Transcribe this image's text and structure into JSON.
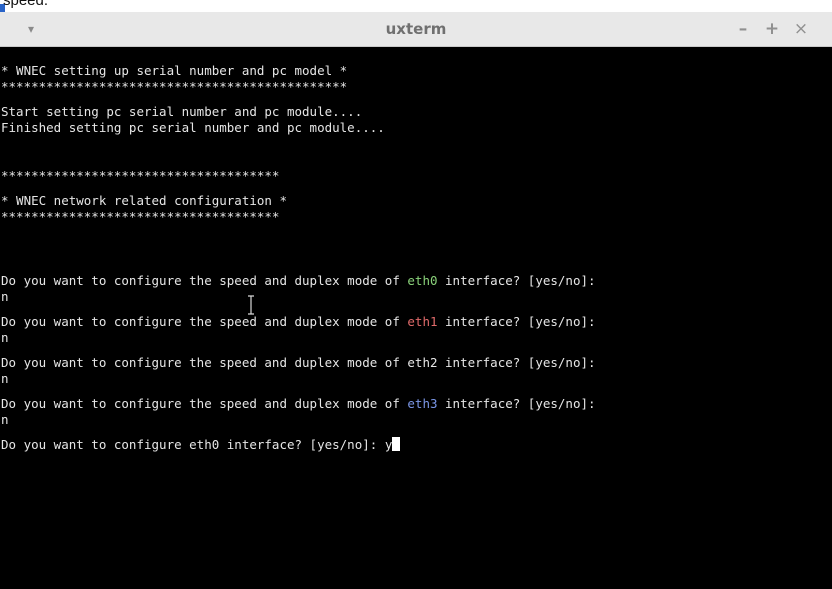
{
  "page": {
    "top_fragment_text": "speed."
  },
  "window": {
    "title": "uxterm",
    "menu_icon": "▾",
    "minimize_label": "–",
    "maximize_label": "+",
    "close_label": "×"
  },
  "terminal": {
    "lines": {
      "l1": "* WNEC setting up serial number and pc model *",
      "l2": "**********************************************",
      "l3": "Start setting pc serial number and pc module....",
      "l4": "Finished setting pc serial number and pc module....",
      "l5": "*************************************",
      "l6": "* WNEC network related configuration *",
      "l7": "*************************************"
    },
    "questions": [
      {
        "prefix": "Do you want to configure the speed and duplex mode of ",
        "iface": "eth0",
        "suffix": " interface? [yes/no]:",
        "answer": "n"
      },
      {
        "prefix": "Do you want to configure the speed and duplex mode of ",
        "iface": "eth1",
        "suffix": " interface? [yes/no]:",
        "answer": "n"
      },
      {
        "prefix": "Do you want to configure the speed and duplex mode of ",
        "iface": "eth2",
        "suffix": " interface? [yes/no]:",
        "answer": "n"
      },
      {
        "prefix": "Do you want to configure the speed and duplex mode of ",
        "iface": "eth3",
        "suffix": " interface? [yes/no]:",
        "answer": "n"
      }
    ],
    "final_prompt": "Do you want to configure eth0 interface? [yes/no]: ",
    "final_input": "y"
  },
  "colors": {
    "eth0": "#8ad27a",
    "eth1": "#e06a6a",
    "eth2": "#e6e6e6",
    "eth3": "#7a96e6",
    "terminal_bg": "#000000",
    "terminal_fg": "#e6e6e6"
  },
  "icons": {
    "window_menu": "chevron-down-icon",
    "mouse_pointer": "text-cursor-ibeam-icon"
  }
}
